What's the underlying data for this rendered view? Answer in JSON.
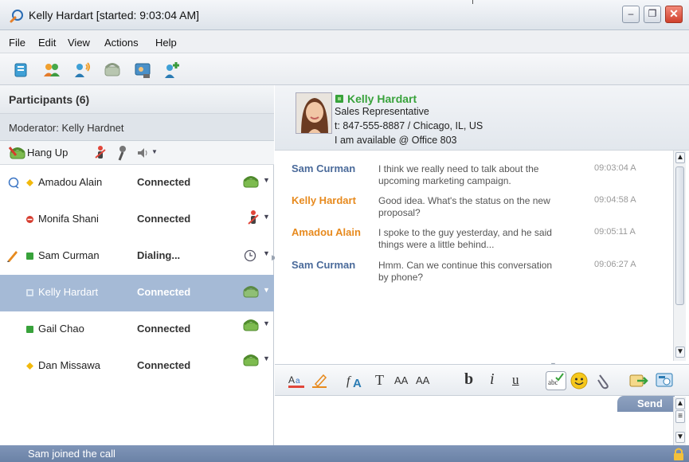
{
  "window": {
    "title": "Kelly Hardart [started: 9:03:04 AM]"
  },
  "menu": [
    "File",
    "Edit",
    "View",
    "Actions",
    "Help"
  ],
  "participants": {
    "header": "Participants (6)",
    "moderator": "Moderator: Kelly Hardnet",
    "hang_up": "Hang Up",
    "rows": [
      {
        "name": "Amadou Alain",
        "status": "Connected",
        "presence": "yellow",
        "selected": false
      },
      {
        "name": "Monifa Shani",
        "status": "Connected",
        "presence": "red",
        "selected": false
      },
      {
        "name": "Sam Curman",
        "status": "Dialing...",
        "presence": "green",
        "selected": false
      },
      {
        "name": "Kelly Hardart",
        "status": "Connected",
        "presence": "green",
        "selected": true
      },
      {
        "name": "Gail Chao",
        "status": "Connected",
        "presence": "green",
        "selected": false
      },
      {
        "name": "Dan Missawa",
        "status": "Connected",
        "presence": "yellow",
        "selected": false
      }
    ]
  },
  "contact": {
    "name": "Kelly Hardart",
    "role": "Sales Representative",
    "phone": "t: 847-555-8887 / Chicago, IL, US",
    "availability": "I am available @ Office 803"
  },
  "messages": [
    {
      "from": "Sam Curman",
      "color": "blue",
      "text": "I think we really need to talk about the upcoming marketing campaign.",
      "time": "09:03:04 A"
    },
    {
      "from": "Kelly Hardart",
      "color": "orange",
      "text": "Good idea. What's the status on the new proposal?",
      "time": "09:04:58 A"
    },
    {
      "from": "Amadou Alain",
      "color": "orange",
      "text": "I spoke to the guy yesterday, and he said things were a little behind...",
      "time": "09:05:11 A"
    },
    {
      "from": "Sam Curman",
      "color": "blue",
      "text": "Hmm. Can we continue this conversation by phone?",
      "time": "09:06:27 A"
    }
  ],
  "format_toolbar": {
    "bold": "b",
    "italic": "i",
    "underline": "u",
    "text": "T",
    "grow": "AA",
    "shrink": "AA"
  },
  "send": "Send",
  "status_bar": "Sam joined the call",
  "colors": {
    "accent": "#38a23b",
    "selected_row": "#a5bad6",
    "status_bar": "#7489ad"
  }
}
